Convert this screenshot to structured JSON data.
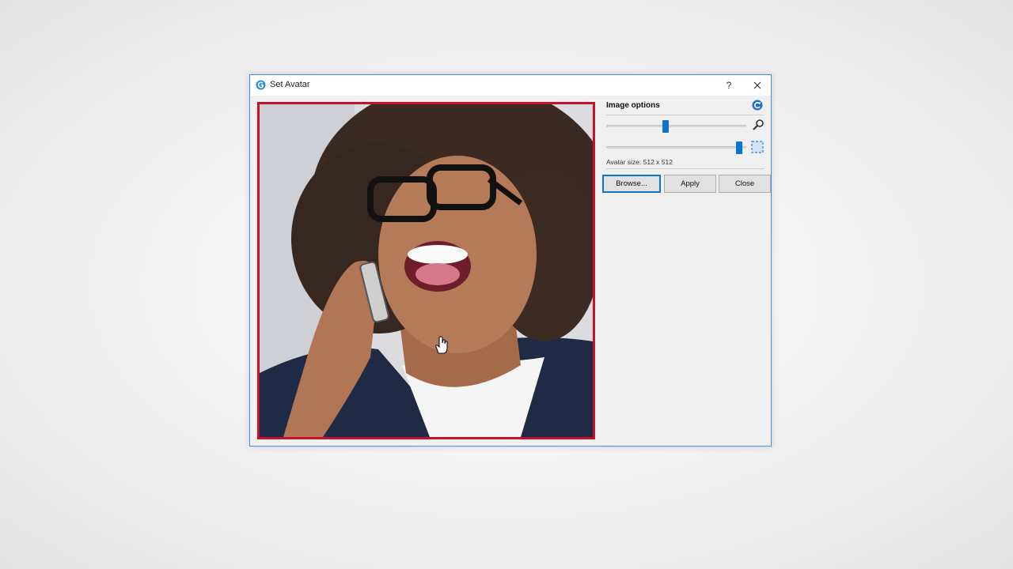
{
  "window": {
    "title": "Set Avatar",
    "help_label": "?"
  },
  "image_options": {
    "heading": "Image options",
    "zoom_level": 0.42,
    "size_level": 0.97,
    "avatar_size_text": "Avatar size: 512 x 512"
  },
  "buttons": {
    "browse": "Browse...",
    "apply": "Apply",
    "close": "Close"
  },
  "colors": {
    "accent": "#0a74d0",
    "frame": "#c8102e"
  }
}
